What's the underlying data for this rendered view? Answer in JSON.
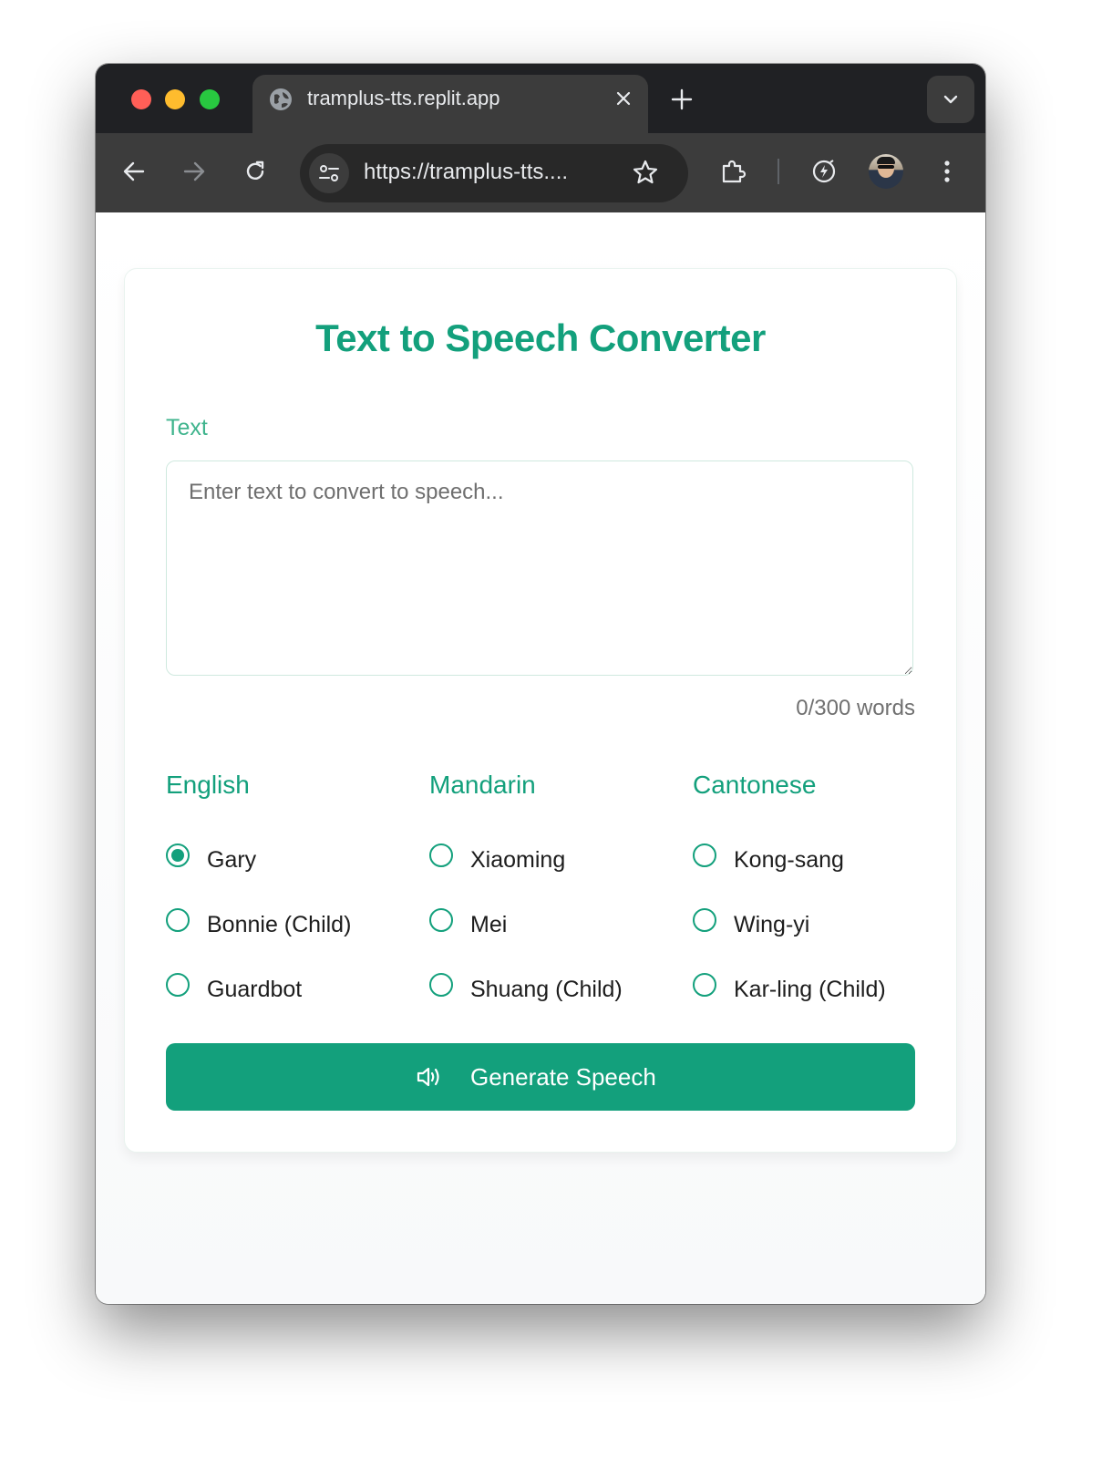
{
  "browser": {
    "tab_title": "tramplus-tts.replit.app",
    "url": "https://tramplus-tts...."
  },
  "page": {
    "title": "Text to Speech Converter",
    "text_label": "Text",
    "textarea_placeholder": "Enter text to convert to speech...",
    "textarea_value": "",
    "word_count": "0/300 words",
    "voice_groups": [
      {
        "heading": "English",
        "options": [
          "Gary",
          "Bonnie (Child)",
          "Guardbot"
        ]
      },
      {
        "heading": "Mandarin",
        "options": [
          "Xiaoming",
          "Mei",
          "Shuang (Child)"
        ]
      },
      {
        "heading": "Cantonese",
        "options": [
          "Kong-sang",
          "Wing-yi",
          "Kar-ling (Child)"
        ]
      }
    ],
    "selected_voice": "Gary",
    "generate_label": "Generate Speech"
  },
  "colors": {
    "accent": "#13a07c",
    "label": "#3fb48d",
    "browser_chrome": "#3c3c3c"
  },
  "icons": [
    "globe-icon",
    "close-icon",
    "plus-icon",
    "chevron-down-icon",
    "back-icon",
    "forward-icon",
    "reload-icon",
    "site-info-icon",
    "star-icon",
    "extensions-icon",
    "lightning-icon",
    "more-icon",
    "speaker-icon"
  ]
}
